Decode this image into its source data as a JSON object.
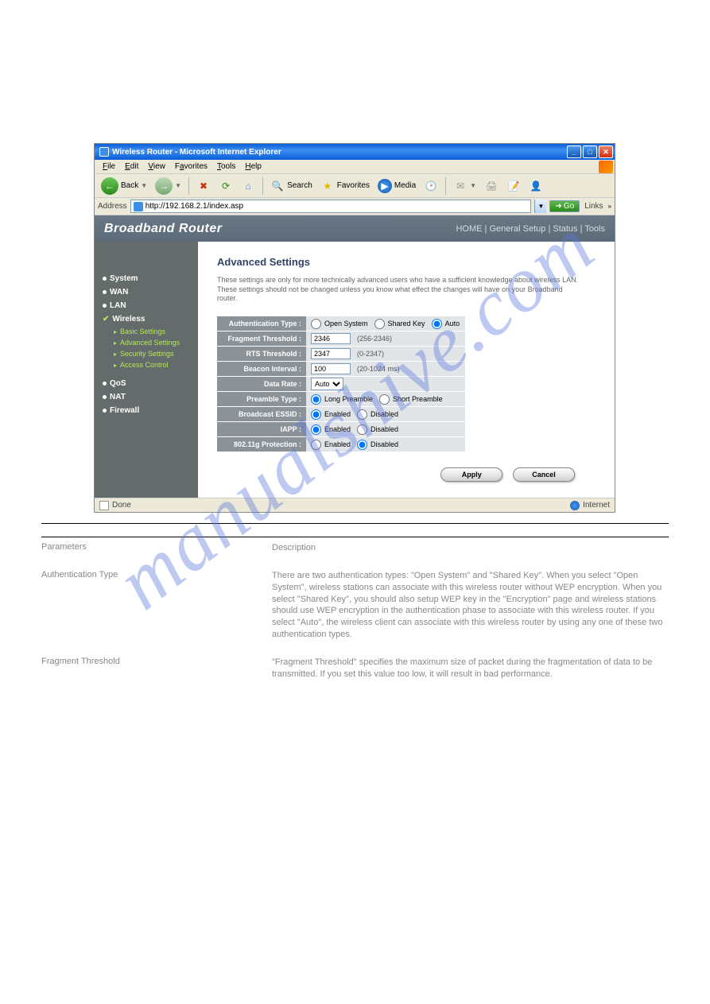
{
  "window": {
    "title": "Wireless Router - Microsoft Internet Explorer",
    "menus": [
      "File",
      "Edit",
      "View",
      "Favorites",
      "Tools",
      "Help"
    ]
  },
  "toolbar": {
    "back": "Back",
    "search": "Search",
    "favorites": "Favorites",
    "media": "Media"
  },
  "address": {
    "label": "Address",
    "url": "http://192.168.2.1/index.asp",
    "go": "Go",
    "links": "Links"
  },
  "banner": {
    "brand": "Broadband Router",
    "nav": "HOME | General Setup | Status | Tools"
  },
  "sidebar": {
    "items": [
      "System",
      "WAN",
      "LAN",
      "Wireless",
      "QoS",
      "NAT",
      "Firewall"
    ],
    "subs": [
      "Basic Settings",
      "Advanced Settings",
      "Security Settings",
      "Access Control"
    ]
  },
  "content": {
    "title": "Advanced Settings",
    "desc": "These settings are only for more technically advanced users who have a sufficient knowledge about wireless LAN. These settings should not be changed unless you know what effect the changes will have on your Broadband router.",
    "rows": {
      "auth": {
        "label": "Authentication Type :",
        "options": [
          "Open System",
          "Shared Key",
          "Auto"
        ],
        "selected": "Auto"
      },
      "frag": {
        "label": "Fragment Threshold :",
        "value": "2346",
        "range": "(256-2346)"
      },
      "rts": {
        "label": "RTS Threshold :",
        "value": "2347",
        "range": "(0-2347)"
      },
      "beacon": {
        "label": "Beacon Interval :",
        "value": "100",
        "range": "(20-1024 ms)"
      },
      "rate": {
        "label": "Data Rate :",
        "value": "Auto"
      },
      "preamble": {
        "label": "Preamble Type :",
        "options": [
          "Long Preamble",
          "Short Preamble"
        ],
        "selected": "Long Preamble"
      },
      "essid": {
        "label": "Broadcast ESSID :",
        "options": [
          "Enabled",
          "Disabled"
        ],
        "selected": "Enabled"
      },
      "iapp": {
        "label": "IAPP :",
        "options": [
          "Enabled",
          "Disabled"
        ],
        "selected": "Enabled"
      },
      "gprot": {
        "label": "802.11g Protection :",
        "options": [
          "Enabled",
          "Disabled"
        ],
        "selected": "Disabled"
      }
    },
    "apply": "Apply",
    "cancel": "Cancel"
  },
  "statusbar": {
    "done": "Done",
    "zone": "Internet"
  },
  "blurbs": {
    "items": [
      {
        "label": "Parameters",
        "text": "Description"
      },
      {
        "label": "Authentication Type",
        "text": "There are two authentication types: \"Open System\" and \"Shared Key\". When you select \"Open System\", wireless stations can associate with this wireless router without WEP encryption. When you select \"Shared Key\", you should also setup WEP key in the \"Encryption\" page and wireless stations should use WEP encryption in the authentication phase to associate with this wireless router. If you select \"Auto\", the wireless client can associate with this wireless router by using any one of these two authentication types."
      },
      {
        "label": "Fragment Threshold",
        "text": "\"Fragment Threshold\" specifies the maximum size of packet during the fragmentation of data to be transmitted. If you set this value too low, it will result in bad performance."
      }
    ]
  },
  "watermark": "manualshive.com"
}
